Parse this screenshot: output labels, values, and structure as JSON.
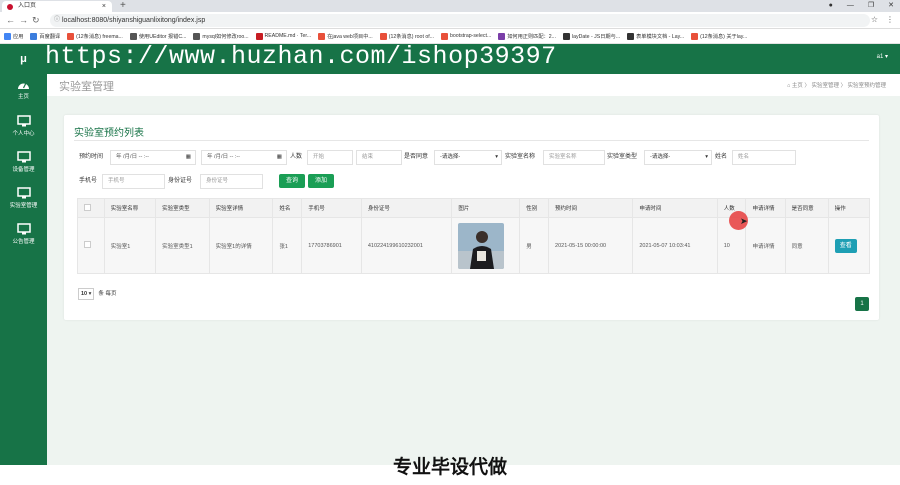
{
  "browser": {
    "tab_title": "入口页",
    "url": "localhost:8080/shiyanshiguanlixitong/index.jsp",
    "bookmarks": [
      {
        "label": "应用",
        "color": "#4285f4"
      },
      {
        "label": "百度翻译",
        "color": "#3b7ddd"
      },
      {
        "label": "(12条消息) freema...",
        "color": "#e8503a"
      },
      {
        "label": "使用UEditor 报错C...",
        "color": "#555555"
      },
      {
        "label": "mysql如何修改roo...",
        "color": "#555555"
      },
      {
        "label": "README.md · Ter...",
        "color": "#c71d23"
      },
      {
        "label": "在java web项目中...",
        "color": "#e8503a"
      },
      {
        "label": "(12条消息) root of...",
        "color": "#e8503a"
      },
      {
        "label": "bootstrap-select...",
        "color": "#e8503a"
      },
      {
        "label": "如何用正则匹配：2...",
        "color": "#7a3ea8"
      },
      {
        "label": "layDate - JS日期与...",
        "color": "#333333"
      },
      {
        "label": "表单模块文档 - Lay...",
        "color": "#333333"
      },
      {
        "label": "(12条消息) 关于lay...",
        "color": "#e8503a"
      }
    ]
  },
  "watermark": "https://www.huzhan.com/ishop39397",
  "sidebar": {
    "logo": "μ",
    "items": [
      {
        "label": "主页",
        "icon": "dashboard-icon"
      },
      {
        "label": "个人中心",
        "icon": "monitor-icon"
      },
      {
        "label": "设备管理",
        "icon": "monitor-icon"
      },
      {
        "label": "实验室管理",
        "icon": "monitor-icon"
      },
      {
        "label": "公告管理",
        "icon": "monitor-icon"
      }
    ]
  },
  "header": {
    "user": "a1 ▾"
  },
  "page": {
    "title": "实验室管理",
    "breadcrumb": "⌂ 主页  〉 实验室管理  〉 实验室预约管理"
  },
  "card": {
    "title": "实验室预约列表"
  },
  "filters": {
    "appoint_time_label": "预约时间",
    "date1": "年 /月/日 -- :--",
    "date2": "年 /月/日 -- :--",
    "people_label": "人数",
    "people_start": "开始",
    "people_end": "结束",
    "agree_label": "是否同意",
    "agree_select": "-请选择-",
    "lab_name_label": "实验室名称",
    "lab_name_ph": "实验室名称",
    "lab_type_label": "实验室类型",
    "lab_type_select": "-请选择-",
    "name_label": "姓名",
    "name_ph": "姓名",
    "phone_label": "手机号",
    "phone_ph": "手机号",
    "idcard_label": "身份证号",
    "idcard_ph": "身份证号",
    "query_btn": "查询",
    "add_btn": "添加"
  },
  "table": {
    "headers": [
      "实验室名称",
      "实验室类型",
      "实验室详情",
      "姓名",
      "手机号",
      "身份证号",
      "图片",
      "性别",
      "预约时间",
      "申请时间",
      "人数",
      "申请详情",
      "是否同意",
      "操作"
    ],
    "rows": [
      {
        "cells": [
          "实验室1",
          "实验室类型1",
          "实验室1的详情",
          "张1",
          "17703786901",
          "410224199610232001",
          "",
          "男",
          "2021-05-15 00:00:00",
          "2021-05-07 10:03:41",
          "10",
          "申请详情",
          "同意"
        ],
        "action": "查看"
      }
    ]
  },
  "pagination": {
    "size": "10",
    "per_page": "条 每页",
    "page": "1"
  },
  "subtitle": "专业毕设代做"
}
